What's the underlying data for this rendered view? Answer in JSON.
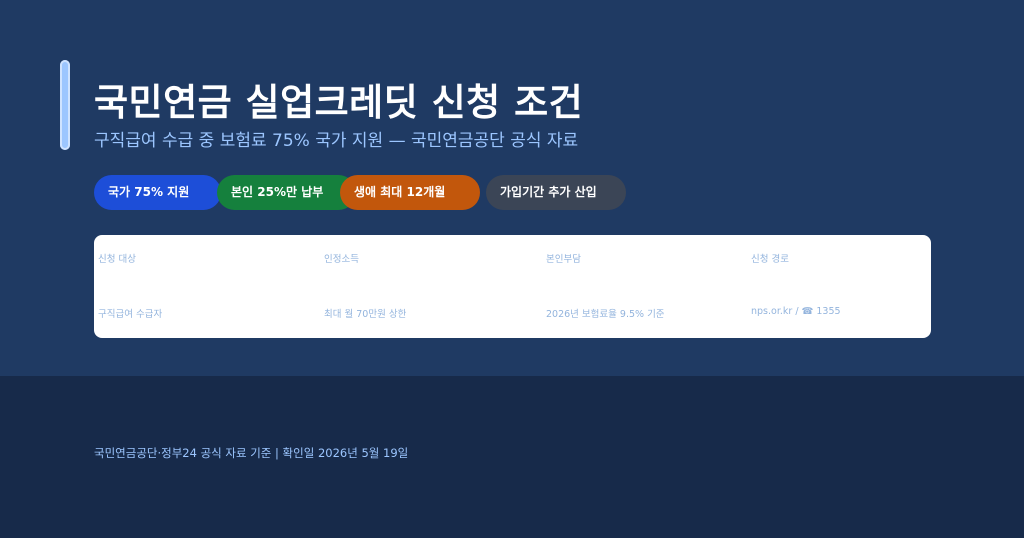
{
  "header": {
    "title": "국민연금 실업크레딧 신청 조건",
    "subtitle": "구직급여 수급 중 보험료 75% 국가 지원 — 국민연금공단 공식 자료"
  },
  "tags": [
    {
      "label": "국가 75% 지원",
      "color": "#1d4ed8"
    },
    {
      "label": "본인 25%만 납부",
      "color": "#15803d"
    },
    {
      "label": "생애 최대 12개월",
      "color": "#c2570c"
    },
    {
      "label": "가입기간 추가 산입",
      "color": "#3b4556"
    }
  ],
  "info": {
    "headers": [
      "신청 대상",
      "인정소득",
      "본인부담",
      "신청 경로"
    ],
    "values": [
      "구직급여 수급자",
      "최대 월 70만원 상한",
      "2026년 보험료율 9.5% 기준",
      "nps.or.kr / ☎ 1355"
    ]
  },
  "footer": {
    "note": "국민연금공단·정부24 공식 자료 기준 | 확인일 2026년 5월 19일"
  }
}
